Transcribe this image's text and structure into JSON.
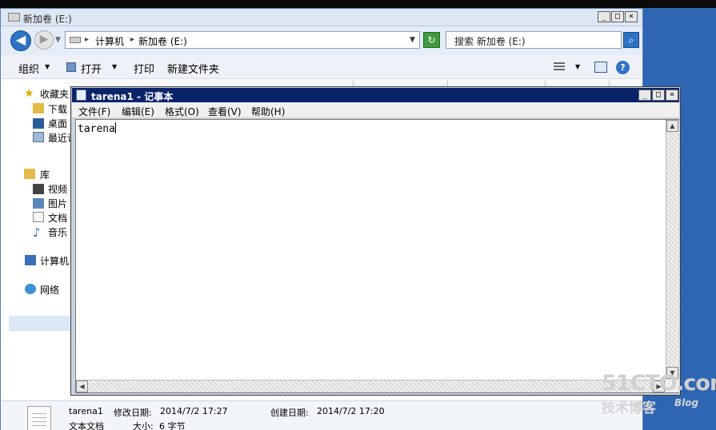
{
  "explorer": {
    "title": "新加卷 (E:)",
    "address": {
      "computer": "计算机",
      "volume": "新加卷 (E:)"
    },
    "search_placeholder": "搜索 新加卷 (E:)",
    "toolbar": {
      "organize": "组织",
      "open": "打开",
      "print": "打印",
      "new_folder": "新建文件夹"
    },
    "nav": {
      "favorites": "收藏夹",
      "downloads": "下载",
      "desktop": "桌面",
      "recent": "最近访",
      "libraries": "库",
      "videos": "视频",
      "pictures": "图片",
      "documents": "文档",
      "music": "音乐",
      "computer": "计算机",
      "network": "网络"
    },
    "details": {
      "filename": "tarena1",
      "modified_label": "修改日期:",
      "modified_value": "2014/7/2 17:27",
      "created_label": "创建日期:",
      "created_value": "2014/7/2 17:20",
      "type": "文本文档",
      "size_label": "大小:",
      "size_value": "6 字节"
    }
  },
  "notepad": {
    "title": "tarena1 - 记事本",
    "menu": {
      "file": "文件(F)",
      "edit": "编辑(E)",
      "format": "格式(O)",
      "view": "查看(V)",
      "help": "帮助(H)"
    },
    "content": "tarena"
  },
  "watermark": {
    "main": "51CTO.com",
    "sub": "技术博客",
    "blog": "Blog"
  },
  "icons": {
    "back": "arrow-left-icon",
    "forward": "arrow-right-icon",
    "refresh": "refresh-icon",
    "search": "search-icon",
    "help": "help-icon"
  },
  "colors": {
    "notepad_titlebar": "#0a246a",
    "desktop": "#3a6ea5",
    "nav_selected": "#dce7f5"
  }
}
